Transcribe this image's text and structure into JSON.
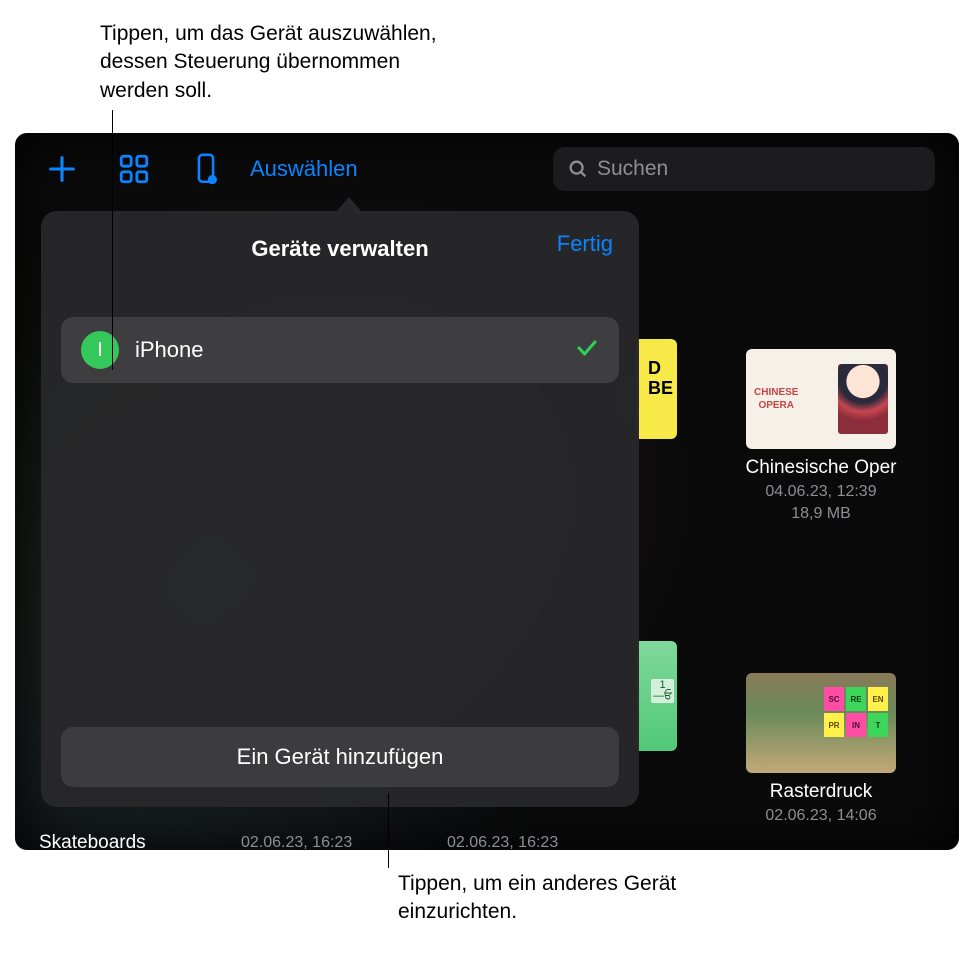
{
  "callouts": {
    "top": "Tippen, um das Gerät auszuwählen, dessen Steuerung übernommen werden soll.",
    "bottom": "Tippen, um ein anderes Gerät einzurichten."
  },
  "toolbar": {
    "select_label": "Auswählen",
    "search_placeholder": "Suchen"
  },
  "popover": {
    "title": "Geräte verwalten",
    "done": "Fertig",
    "device_initial": "I",
    "device_name": "iPhone",
    "add_device": "Ein Gerät hinzufügen"
  },
  "files": {
    "opera": {
      "name": "Chinesische Oper",
      "date": "04.06.23, 12:39",
      "size": "18,9 MB",
      "thumb_text": "CHINESE\nOPERA"
    },
    "raster": {
      "name": "Rasterdruck",
      "date": "02.06.23, 14:06"
    },
    "skateboards": {
      "name": "Skateboards",
      "date": "02.06.23, 16:23"
    },
    "mid": {
      "date": "02.06.23, 16:23"
    }
  }
}
